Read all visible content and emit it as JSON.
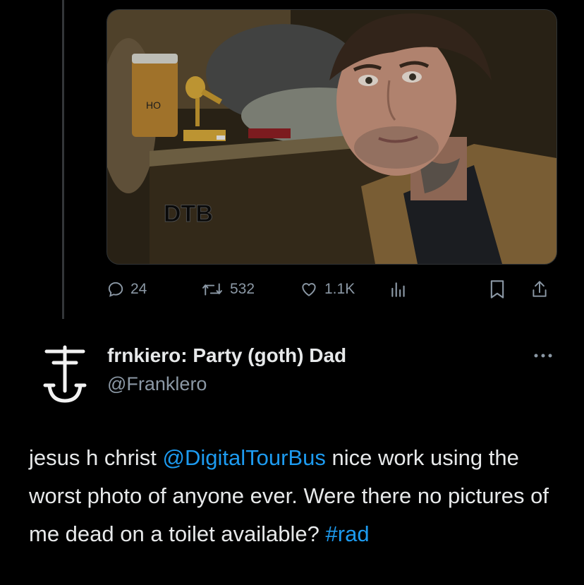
{
  "media": {
    "overlay_text": "DTB",
    "jar_label": "HO",
    "colors": {
      "background": "#3a3020",
      "sweater": "#8a6a3c"
    }
  },
  "actions": {
    "replies": "24",
    "reposts": "532",
    "likes": "1.1K",
    "views_icon": "bar-chart-icon",
    "bookmark_icon": "bookmark-icon",
    "share_icon": "share-icon"
  },
  "reply": {
    "display_name": "frnkiero: Party (goth) Dad",
    "handle": "@Franklero",
    "text": {
      "part1": "jesus h christ ",
      "mention": "@DigitalTourBus",
      "part2": " nice work using the worst photo of anyone ever. Were there no pictures of me dead on a toilet available? ",
      "hashtag": "#rad"
    }
  },
  "colors": {
    "background": "#000000",
    "text_primary": "#e7e9ea",
    "text_secondary": "#8b98a5",
    "link": "#1d9bf0"
  }
}
